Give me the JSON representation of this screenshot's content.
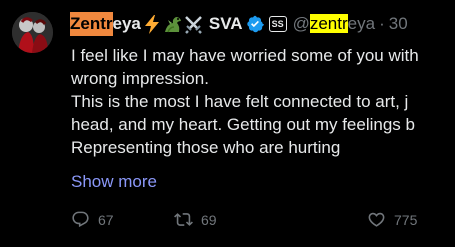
{
  "header": {
    "name_highlighted": "Zentr",
    "name_rest": "eya",
    "name_suffix": "SVA",
    "affiliation_badge": "SS",
    "handle_prefix": "@",
    "handle_highlighted": "zentr",
    "handle_rest": "eya",
    "separator": "·",
    "time": "30",
    "emojis": [
      "lightning-emoji",
      "dragon-emoji",
      "crossed-swords-emoji"
    ]
  },
  "body": {
    "lines": [
      "I feel like I may have worried some of you with",
      "wrong impression.",
      "This is the most I have felt connected to art, j",
      "head, and my heart. Getting out my feelings b",
      "Representing those who are hurting"
    ]
  },
  "show_more": "Show more",
  "actions": {
    "reply": "67",
    "repost": "69",
    "like": "775"
  },
  "colors": {
    "background": "#000000",
    "text": "#e7e9ea",
    "muted": "#71767b",
    "link": "#8b98f9",
    "highlight_orange": "#f0883e",
    "highlight_yellow": "#ffff00",
    "verified": "#1d9bf0"
  }
}
